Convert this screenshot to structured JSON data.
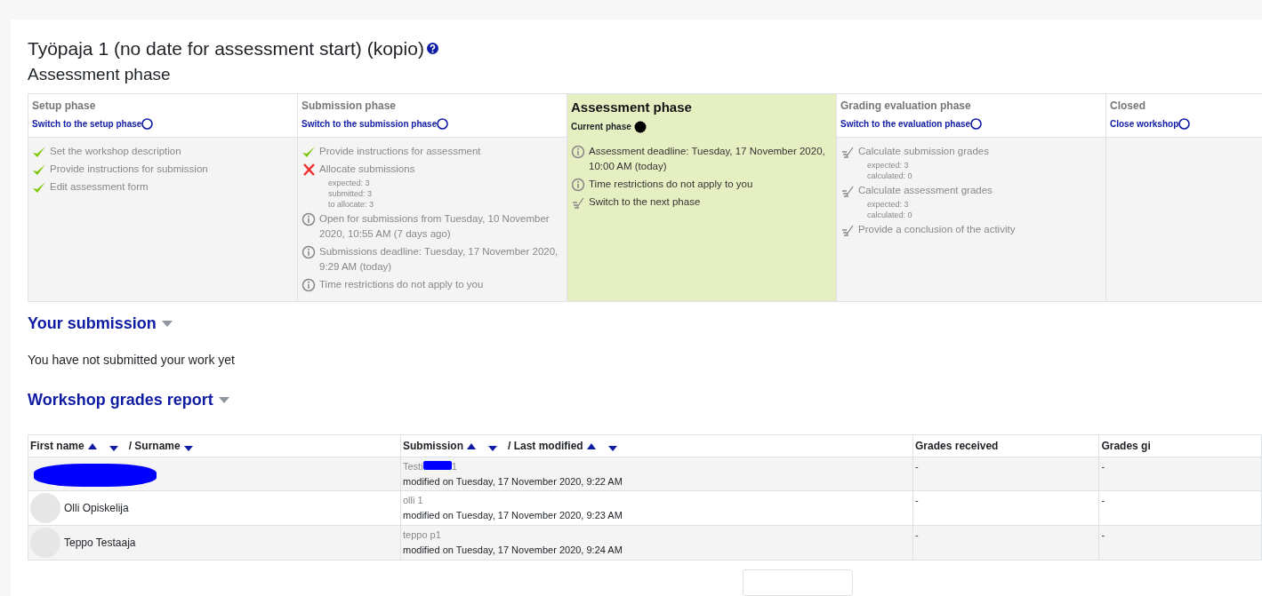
{
  "title": "Työpaja 1 (no date for assessment start) (kopio)",
  "phase_heading": "Assessment phase",
  "phases": [
    {
      "name": "Setup phase",
      "current": false,
      "action": "Switch to the setup phase",
      "tasks": [
        {
          "kind": "done",
          "text": "Set the workshop description"
        },
        {
          "kind": "done",
          "text": "Provide instructions for submission"
        },
        {
          "kind": "done",
          "text": "Edit assessment form"
        }
      ]
    },
    {
      "name": "Submission phase",
      "current": false,
      "action": "Switch to the submission phase",
      "tasks": [
        {
          "kind": "done",
          "text": "Provide instructions for assessment"
        },
        {
          "kind": "fail",
          "text": "Allocate submissions",
          "details": [
            "expected: 3",
            "submitted: 3",
            "to allocate: 3"
          ]
        },
        {
          "kind": "info",
          "text": "Open for submissions from Tuesday, 10 November 2020, 10:55 AM (7 days ago)"
        },
        {
          "kind": "info",
          "text": "Submissions deadline: Tuesday, 17 November 2020, 9:29 AM (today)"
        },
        {
          "kind": "info",
          "text": "Time restrictions do not apply to you"
        }
      ]
    },
    {
      "name": "Assessment phase",
      "current": true,
      "action": "Current phase",
      "tasks": [
        {
          "kind": "info",
          "text": "Assessment deadline: Tuesday, 17 November 2020, 10:00 AM (today)"
        },
        {
          "kind": "info",
          "text": "Time restrictions do not apply to you"
        },
        {
          "kind": "todo",
          "text": "Switch to the next phase"
        }
      ]
    },
    {
      "name": "Grading evaluation phase",
      "current": false,
      "action": "Switch to the evaluation phase",
      "tasks": [
        {
          "kind": "todo",
          "text": "Calculate submission grades",
          "details": [
            "expected: 3",
            "calculated: 0"
          ]
        },
        {
          "kind": "todo",
          "text": "Calculate assessment grades",
          "details": [
            "expected: 3",
            "calculated: 0"
          ]
        },
        {
          "kind": "todo",
          "text": "Provide a conclusion of the activity"
        }
      ]
    },
    {
      "name": "Closed",
      "current": false,
      "action": "Close workshop"
    }
  ],
  "your_submission": {
    "heading": "Your submission",
    "text": "You have not submitted your work yet"
  },
  "grades_report": {
    "heading": "Workshop grades report",
    "columns": [
      {
        "parts": [
          {
            "text": "First name",
            "asc_arrow": true,
            "desc_arrow": true
          },
          {
            "text": "/ Surname",
            "asc_arrow": false,
            "desc_arrow": true
          }
        ]
      },
      {
        "parts": [
          {
            "text": "Submission",
            "asc_arrow": true,
            "desc_arrow": true
          },
          {
            "text": "/ Last modified",
            "asc_arrow": true,
            "desc_arrow": true
          }
        ]
      },
      {
        "parts": [
          {
            "text": "Grades received"
          }
        ]
      },
      {
        "parts": [
          {
            "text": "Grades gi"
          }
        ]
      }
    ],
    "rows": [
      {
        "name_redacted": true,
        "submission_title": "Testi",
        "submission_title_end": "1",
        "title_redacted": true,
        "modified": "modified on Tuesday, 17 November 2020, 9:22 AM",
        "grades_received": "-",
        "grades_given": "-"
      },
      {
        "name": "Olli Opiskelija",
        "name_redacted": false,
        "submission_title": "olli 1",
        "title_redacted": false,
        "modified": "modified on Tuesday, 17 November 2020, 9:23 AM",
        "grades_received": "-",
        "grades_given": "-"
      },
      {
        "name": "Teppo Testaaja",
        "name_redacted": false,
        "submission_title": "teppo p1",
        "title_redacted": false,
        "modified": "modified on Tuesday, 17 November 2020, 9:24 AM",
        "grades_received": "-",
        "grades_given": "-"
      }
    ]
  }
}
